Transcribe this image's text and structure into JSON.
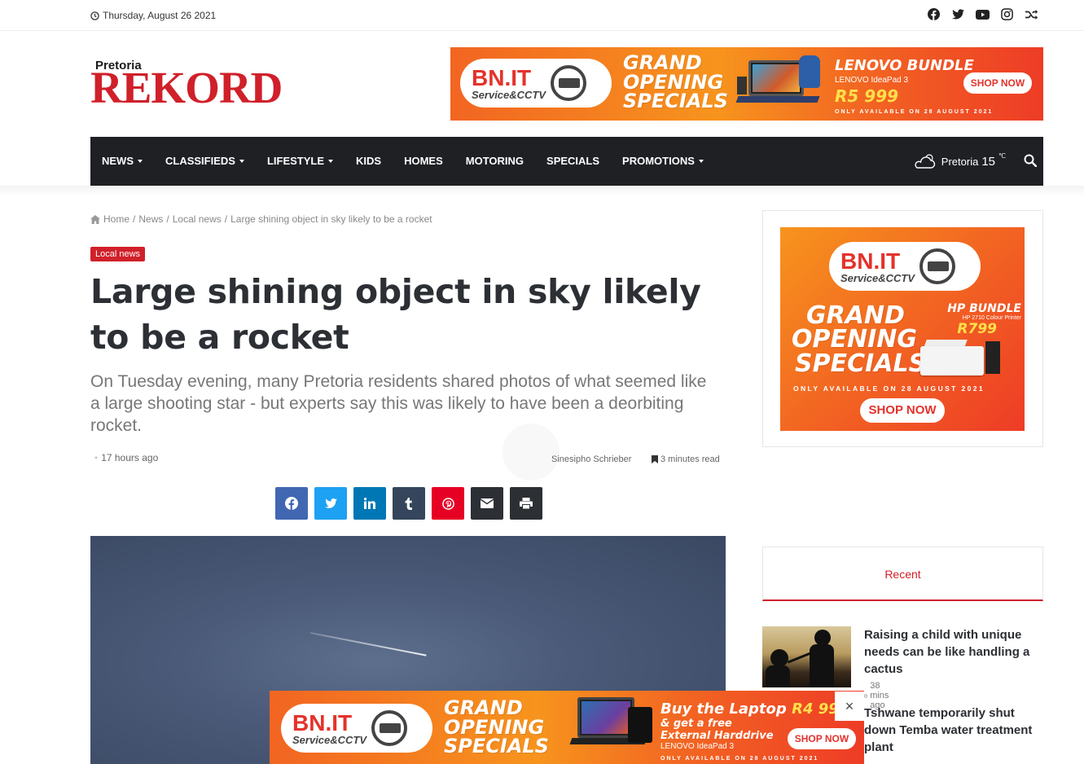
{
  "topbar": {
    "date": "Thursday, August 26 2021",
    "social_icons": [
      "facebook-icon",
      "twitter-icon",
      "youtube-icon",
      "instagram-icon",
      "random-icon"
    ]
  },
  "logo": {
    "small": "Pretoria",
    "big": "REKORD"
  },
  "top_banner": {
    "brand": "BN.IT",
    "brand_sub": "Service&CCTV",
    "headline_1": "GRAND",
    "headline_2": "OPENING",
    "headline_3": "SPECIALS",
    "product": "LENOVO BUNDLE",
    "product_model": "LENOVO IdeaPad 3",
    "price": "R5 999",
    "cta": "SHOP NOW",
    "fine_print": "ONLY AVAILABLE ON 28 AUGUST 2021"
  },
  "nav": {
    "items": [
      {
        "label": "NEWS",
        "dropdown": true
      },
      {
        "label": "CLASSIFIEDS",
        "dropdown": true
      },
      {
        "label": "LIFESTYLE",
        "dropdown": true
      },
      {
        "label": "KIDS",
        "dropdown": false
      },
      {
        "label": "HOMES",
        "dropdown": false
      },
      {
        "label": "MOTORING",
        "dropdown": false
      },
      {
        "label": "SPECIALS",
        "dropdown": false
      },
      {
        "label": "PROMOTIONS",
        "dropdown": true
      }
    ],
    "weather_city": "Pretoria",
    "weather_temp": "15",
    "weather_unit": "℃"
  },
  "breadcrumb": {
    "home": "Home",
    "sep": "/",
    "news": "News",
    "local": "Local news",
    "current": "Large shining object in sky likely to be a rocket"
  },
  "article": {
    "category": "Local news",
    "title": "Large shining object in sky likely to be a rocket",
    "excerpt": "On Tuesday evening, many Pretoria residents shared photos of what seemed like a large shooting star - but experts say this was likely to have been a deorbiting rocket.",
    "time": "17 hours ago",
    "author": "Sinesipho Schrieber",
    "read_time": "3 minutes read"
  },
  "share": {
    "buttons": [
      {
        "name": "facebook",
        "color": "#4267b2"
      },
      {
        "name": "twitter",
        "color": "#1da1f2"
      },
      {
        "name": "linkedin",
        "color": "#0077b5"
      },
      {
        "name": "tumblr",
        "color": "#35465c"
      },
      {
        "name": "pinterest",
        "color": "#e60023"
      },
      {
        "name": "email",
        "color": "#2c2f34"
      },
      {
        "name": "print",
        "color": "#2c2f34"
      }
    ]
  },
  "side_ad": {
    "brand": "BN.IT",
    "brand_sub": "Service&CCTV",
    "headline_1": "GRAND",
    "headline_2": "OPENING",
    "headline_3": "SPECIALS",
    "product": "HP BUNDLE",
    "product_model": "HP 2710 Colour Printer",
    "price": "R799",
    "fine_print": "ONLY AVAILABLE ON 28 AUGUST 2021",
    "cta": "SHOP NOW"
  },
  "sidebar": {
    "recent_label": "Recent",
    "posts": [
      {
        "title": "Raising a child with unique needs can be like handling a cactus",
        "time": "38 mins ago"
      },
      {
        "title": "Tshwane temporarily shut down Temba water treatment plant",
        "time": ""
      }
    ]
  },
  "sticky_ad": {
    "brand": "BN.IT",
    "brand_sub": "Service&CCTV",
    "headline_1": "GRAND",
    "headline_2": "OPENING",
    "headline_3": "SPECIALS",
    "offer_1": "Buy the Laptop",
    "price": "R4 99",
    "offer_2": "& get a free",
    "offer_3": "External Harddrive",
    "product_model": "LENOVO IdeaPad 3",
    "cta": "SHOP NOW",
    "fine_print": "ONLY AVAILABLE ON 28 AUGUST 2021",
    "close": "×"
  },
  "colors": {
    "brand_red": "#d0202a",
    "nav_bg": "#1f2024",
    "ad_orange": "#f26522"
  }
}
